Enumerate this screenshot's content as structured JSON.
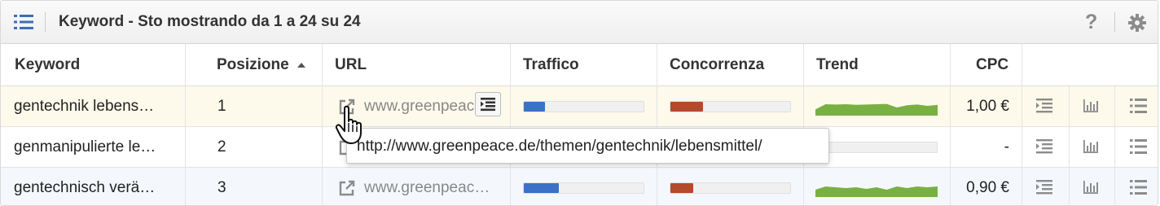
{
  "header": {
    "title": "Keyword - Sto mostrando da 1 a 24 su 24",
    "help_label": "?"
  },
  "columns": {
    "keyword": "Keyword",
    "position": "Posizione",
    "url": "URL",
    "traffic": "Traffico",
    "competition": "Concorrenza",
    "trend": "Trend",
    "cpc": "CPC"
  },
  "rows": [
    {
      "keyword": "gentechnik lebens…",
      "position": "1",
      "url": "www.greenpeace",
      "traffic": 0.18,
      "competition": 0.27,
      "trend": [
        0.62,
        0.3,
        0.32,
        0.3,
        0.34,
        0.32,
        0.3,
        0.28,
        0.5,
        0.36,
        0.32,
        0.4,
        0.34
      ],
      "cpc": "1,00 €"
    },
    {
      "keyword": "genmanipulierte le…",
      "position": "2",
      "url": "",
      "traffic": 0.0,
      "competition": 0.0,
      "trend": [],
      "cpc": "-"
    },
    {
      "keyword": "gentechnisch verä…",
      "position": "3",
      "url": "www.greenpeac…",
      "traffic": 0.29,
      "competition": 0.19,
      "trend": [
        0.55,
        0.35,
        0.4,
        0.45,
        0.4,
        0.5,
        0.4,
        0.55,
        0.35,
        0.45,
        0.35,
        0.4,
        0.35
      ],
      "cpc": "0,90 €"
    }
  ],
  "tooltip": {
    "text": "http://www.greenpeace.de/themen/gentechnik/lebensmittel/"
  },
  "colors": {
    "traffic_fill": "#3a72c6",
    "competition_fill": "#b5492b",
    "trend_fill": "#79b043",
    "row1_bg": "#fdfaeb",
    "row3_bg": "#f4f8fc",
    "icon_gray": "#8c8c8c"
  },
  "icons": {
    "header_left": "list-icon",
    "header_right": "gear-icon",
    "url_link": "external-link-icon",
    "row_actions": [
      "serp-icon",
      "bar-chart-icon",
      "list-icon"
    ]
  }
}
